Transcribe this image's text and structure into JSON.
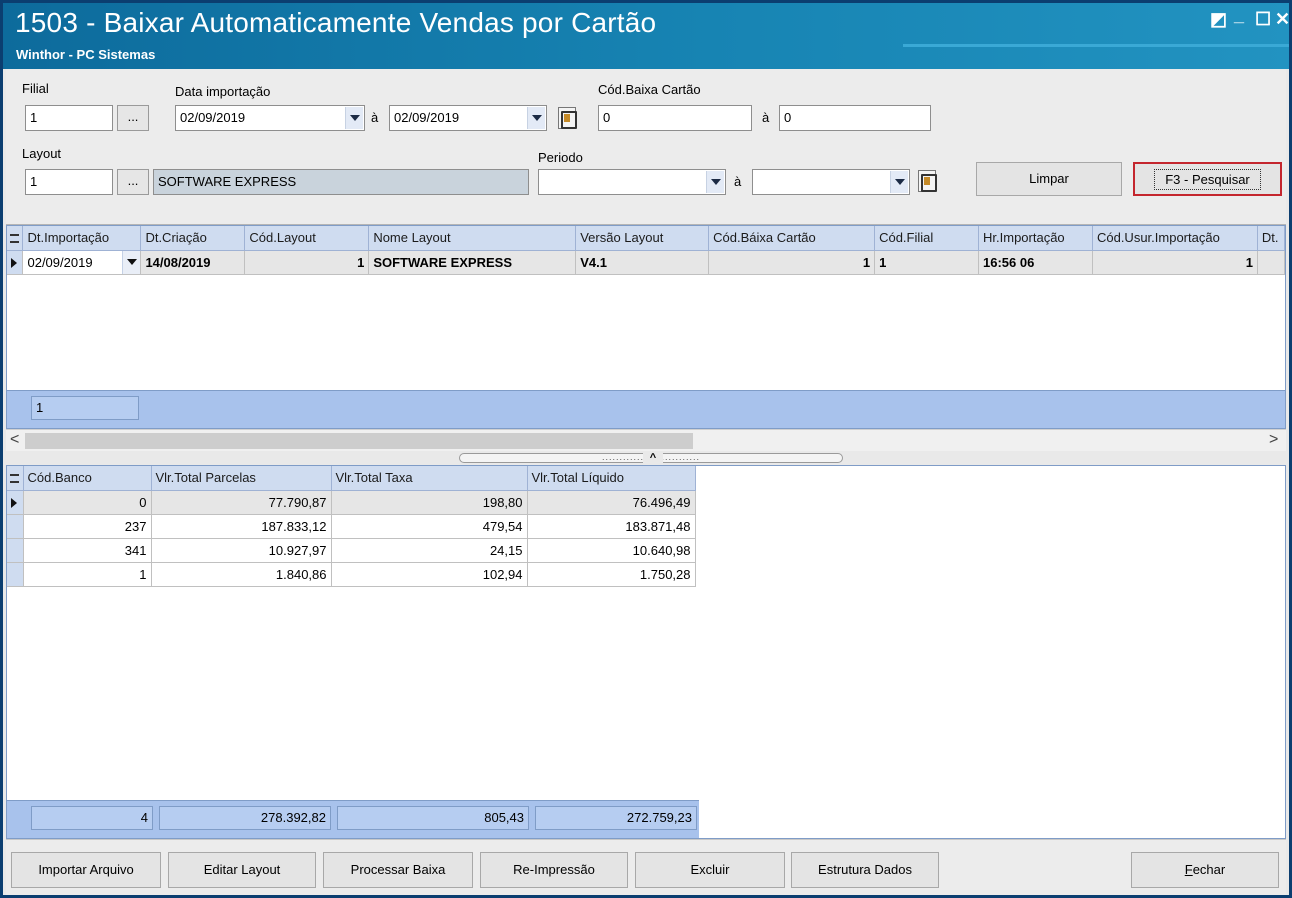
{
  "window": {
    "title": "1503 - Baixar Automaticamente Vendas por Cartão",
    "subtitle": "Winthor - PC Sistemas",
    "controls": {
      "restore": "◩",
      "minimize": "_",
      "maximize": "☐",
      "close": "✕"
    }
  },
  "filters": {
    "filial_label": "Filial",
    "filial_value": "1",
    "dots": "...",
    "data_importacao_label": "Data importação",
    "data_ini": "02/09/2019",
    "ate": "à",
    "data_fim": "02/09/2019",
    "cod_baixa_label": "Cód.Baixa Cartão",
    "cod_baixa_ini": "0",
    "cod_baixa_fim": "0",
    "layout_label": "Layout",
    "layout_value": "1",
    "layout_desc": "SOFTWARE EXPRESS",
    "periodo_label": "Periodo",
    "periodo_ini": "",
    "periodo_fim": "",
    "limpar_label": "Limpar",
    "pesquisar_label": "F3 - Pesquisar"
  },
  "main_grid": {
    "columns": [
      "Dt.Importação",
      "Dt.Criação",
      "Cód.Layout",
      "Nome Layout",
      "Versão Layout",
      "Cód.Báixa Cartão",
      "Cód.Filial",
      "Hr.Importação",
      "Cód.Usur.Importação",
      "Dt."
    ],
    "rows": [
      [
        "02/09/2019",
        "14/08/2019",
        "1",
        "SOFTWARE EXPRESS",
        "V4.1",
        "1",
        "1",
        "16:56 06",
        "1",
        ""
      ]
    ],
    "footer_count": "1"
  },
  "detail_grid": {
    "columns": [
      "Cód.Banco",
      "Vlr.Total Parcelas",
      "Vlr.Total Taxa",
      "Vlr.Total Líquido"
    ],
    "rows": [
      [
        "0",
        "77.790,87",
        "198,80",
        "76.496,49"
      ],
      [
        "237",
        "187.833,12",
        "479,54",
        "183.871,48"
      ],
      [
        "341",
        "10.927,97",
        "24,15",
        "10.640,98"
      ],
      [
        "1",
        "1.840,86",
        "102,94",
        "1.750,28"
      ]
    ],
    "totals": [
      "4",
      "278.392,82",
      "805,43",
      "272.759,23"
    ]
  },
  "scroll": {
    "left": "<",
    "right": ">"
  },
  "splitter": {
    "dots": "............................",
    "caret": "^"
  },
  "buttons": {
    "importar": "Importar Arquivo",
    "editar": "Editar Layout",
    "processar": "Processar Baixa",
    "reimpressao": "Re-Impressão",
    "excluir": "Excluir",
    "estrutura": "Estrutura Dados",
    "fechar_first": "F",
    "fechar_rest": "echar"
  },
  "colors": {
    "title_bar": "#1784b3",
    "grid_header": "#cfdcf0",
    "footer": "#a8c2ec",
    "focus_border": "#c4262e"
  }
}
